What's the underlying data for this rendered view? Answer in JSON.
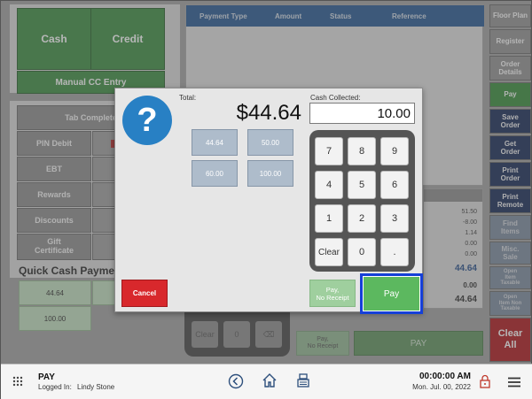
{
  "background": {
    "cash_label": "Cash",
    "credit_label": "Credit",
    "manual_cc_label": "Manual CC Entry",
    "tab_complete_label": "Tab Complete",
    "pin_debit_label": "PIN Debit",
    "ebt_label": "EBT",
    "rewards_label": "Rewards",
    "discounts_label": "Discounts",
    "gift_certificate_label": "Gift\nCertificate",
    "quick_cash_title": "Quick Cash Payments",
    "quick_cash_1": "44.64",
    "quick_cash_2": "100.00",
    "table_headers": [
      "Payment Type",
      "Amount",
      "Status",
      "Reference"
    ],
    "summary_values": [
      "51.50",
      "-8.00",
      "1.14",
      "0.00",
      "0.00"
    ],
    "summary_total": "44.64",
    "summary_zero": "0.00",
    "summary_due": "44.64",
    "clear_key": "Clear",
    "zero_key": "0",
    "pay_no_receipt_label": "Pay,\nNo Receipt",
    "pay_label": "PAY"
  },
  "sidebar": {
    "items": [
      {
        "label": "Floor Plan"
      },
      {
        "label": "Register"
      },
      {
        "label": "Order\nDetails"
      },
      {
        "label": "Pay"
      },
      {
        "label": "Save\nOrder"
      },
      {
        "label": "Get\nOrder"
      },
      {
        "label": "Print\nOrder"
      },
      {
        "label": "Print\nRemote"
      },
      {
        "label": "Find\nItems"
      },
      {
        "label": "Misc.\nSale"
      },
      {
        "label": "Open\nItem\nTaxable"
      },
      {
        "label": "Open\nItem Non\nTaxable"
      },
      {
        "label": "Clear\nAll"
      }
    ]
  },
  "dialog": {
    "total_label": "Total:",
    "total_value": "$44.64",
    "cash_collected_label": "Cash Collected:",
    "cash_collected_value": "10.00",
    "quick_amounts": [
      "44.64",
      "50.00",
      "60.00",
      "100.00"
    ],
    "keys": [
      "7",
      "8",
      "9",
      "4",
      "5",
      "6",
      "1",
      "2",
      "3",
      "Clear",
      "0",
      "."
    ],
    "cancel_label": "Cancel",
    "pay_no_receipt_label": "Pay,\nNo Receipt",
    "pay_label": "Pay"
  },
  "status_bar": {
    "screen_title": "PAY",
    "logged_in_prefix": "Logged In:",
    "user_name": "Lindy Stone",
    "time": "00:00:00 AM",
    "date": "Mon. Jul. 00, 2022"
  },
  "colors": {
    "accent_blue": "#2880c4",
    "pay_green": "#5cb85f",
    "cancel_red": "#d8282c",
    "focus_outline": "#1540d8"
  },
  "icons": [
    "grid-icon",
    "back-circle-icon",
    "home-icon",
    "register-icon",
    "lock-icon",
    "menu-icon",
    "question-icon"
  ]
}
